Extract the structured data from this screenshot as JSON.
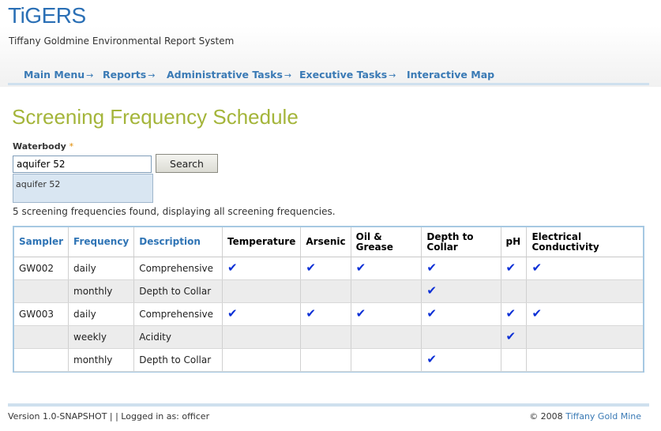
{
  "app": {
    "logo": "TiGERS",
    "subtitle": "Tiffany Goldmine Environmental Report System"
  },
  "nav": {
    "items": [
      {
        "label": "Main Menu",
        "arrow": "→"
      },
      {
        "label": "Reports",
        "arrow": "→"
      },
      {
        "label": "Administrative Tasks",
        "arrow": "→"
      },
      {
        "label": "Executive Tasks",
        "arrow": "→"
      },
      {
        "label": "Interactive Map",
        "arrow": ""
      }
    ]
  },
  "page": {
    "title": "Screening Frequency Schedule"
  },
  "form": {
    "waterbody_label": "Waterbody",
    "required_mark": "*",
    "search_value": "aquifer 52",
    "search_button": "Search",
    "suggestion": "aquifer 52"
  },
  "results": {
    "message": "5 screening frequencies found, displaying all screening frequencies."
  },
  "table": {
    "headers": [
      "Sampler",
      "Frequency",
      "Description",
      "Temperature",
      "Arsenic",
      "Oil & Grease",
      "Depth to Collar",
      "pH",
      "Electrical Conductivity"
    ],
    "header_lines": {
      "oil1": "Oil &",
      "oil2": "Grease",
      "depth1": "Depth to",
      "depth2": "Collar",
      "ec1": "Electrical",
      "ec2": "Conductivity"
    },
    "check_mark": "✔",
    "rows": [
      {
        "sampler": "GW002",
        "frequency": "daily",
        "description": "Comprehensive",
        "checks": [
          true,
          true,
          true,
          true,
          true,
          true
        ]
      },
      {
        "sampler": "",
        "frequency": "monthly",
        "description": "Depth to Collar",
        "checks": [
          false,
          false,
          false,
          true,
          false,
          false
        ]
      },
      {
        "sampler": "GW003",
        "frequency": "daily",
        "description": "Comprehensive",
        "checks": [
          true,
          true,
          true,
          true,
          true,
          true
        ]
      },
      {
        "sampler": "",
        "frequency": "weekly",
        "description": "Acidity",
        "checks": [
          false,
          false,
          false,
          false,
          true,
          false
        ]
      },
      {
        "sampler": "",
        "frequency": "monthly",
        "description": "Depth to Collar",
        "checks": [
          false,
          false,
          false,
          true,
          false,
          false
        ]
      }
    ]
  },
  "footer": {
    "version": "Version 1.0-SNAPSHOT | | Logged in as: officer",
    "copyright": "© 2008",
    "company": "Tiffany Gold Mine"
  },
  "colors": {
    "brand_blue": "#2a6fb5",
    "title_green": "#a4b53a",
    "check_blue": "#0b2fd6"
  }
}
